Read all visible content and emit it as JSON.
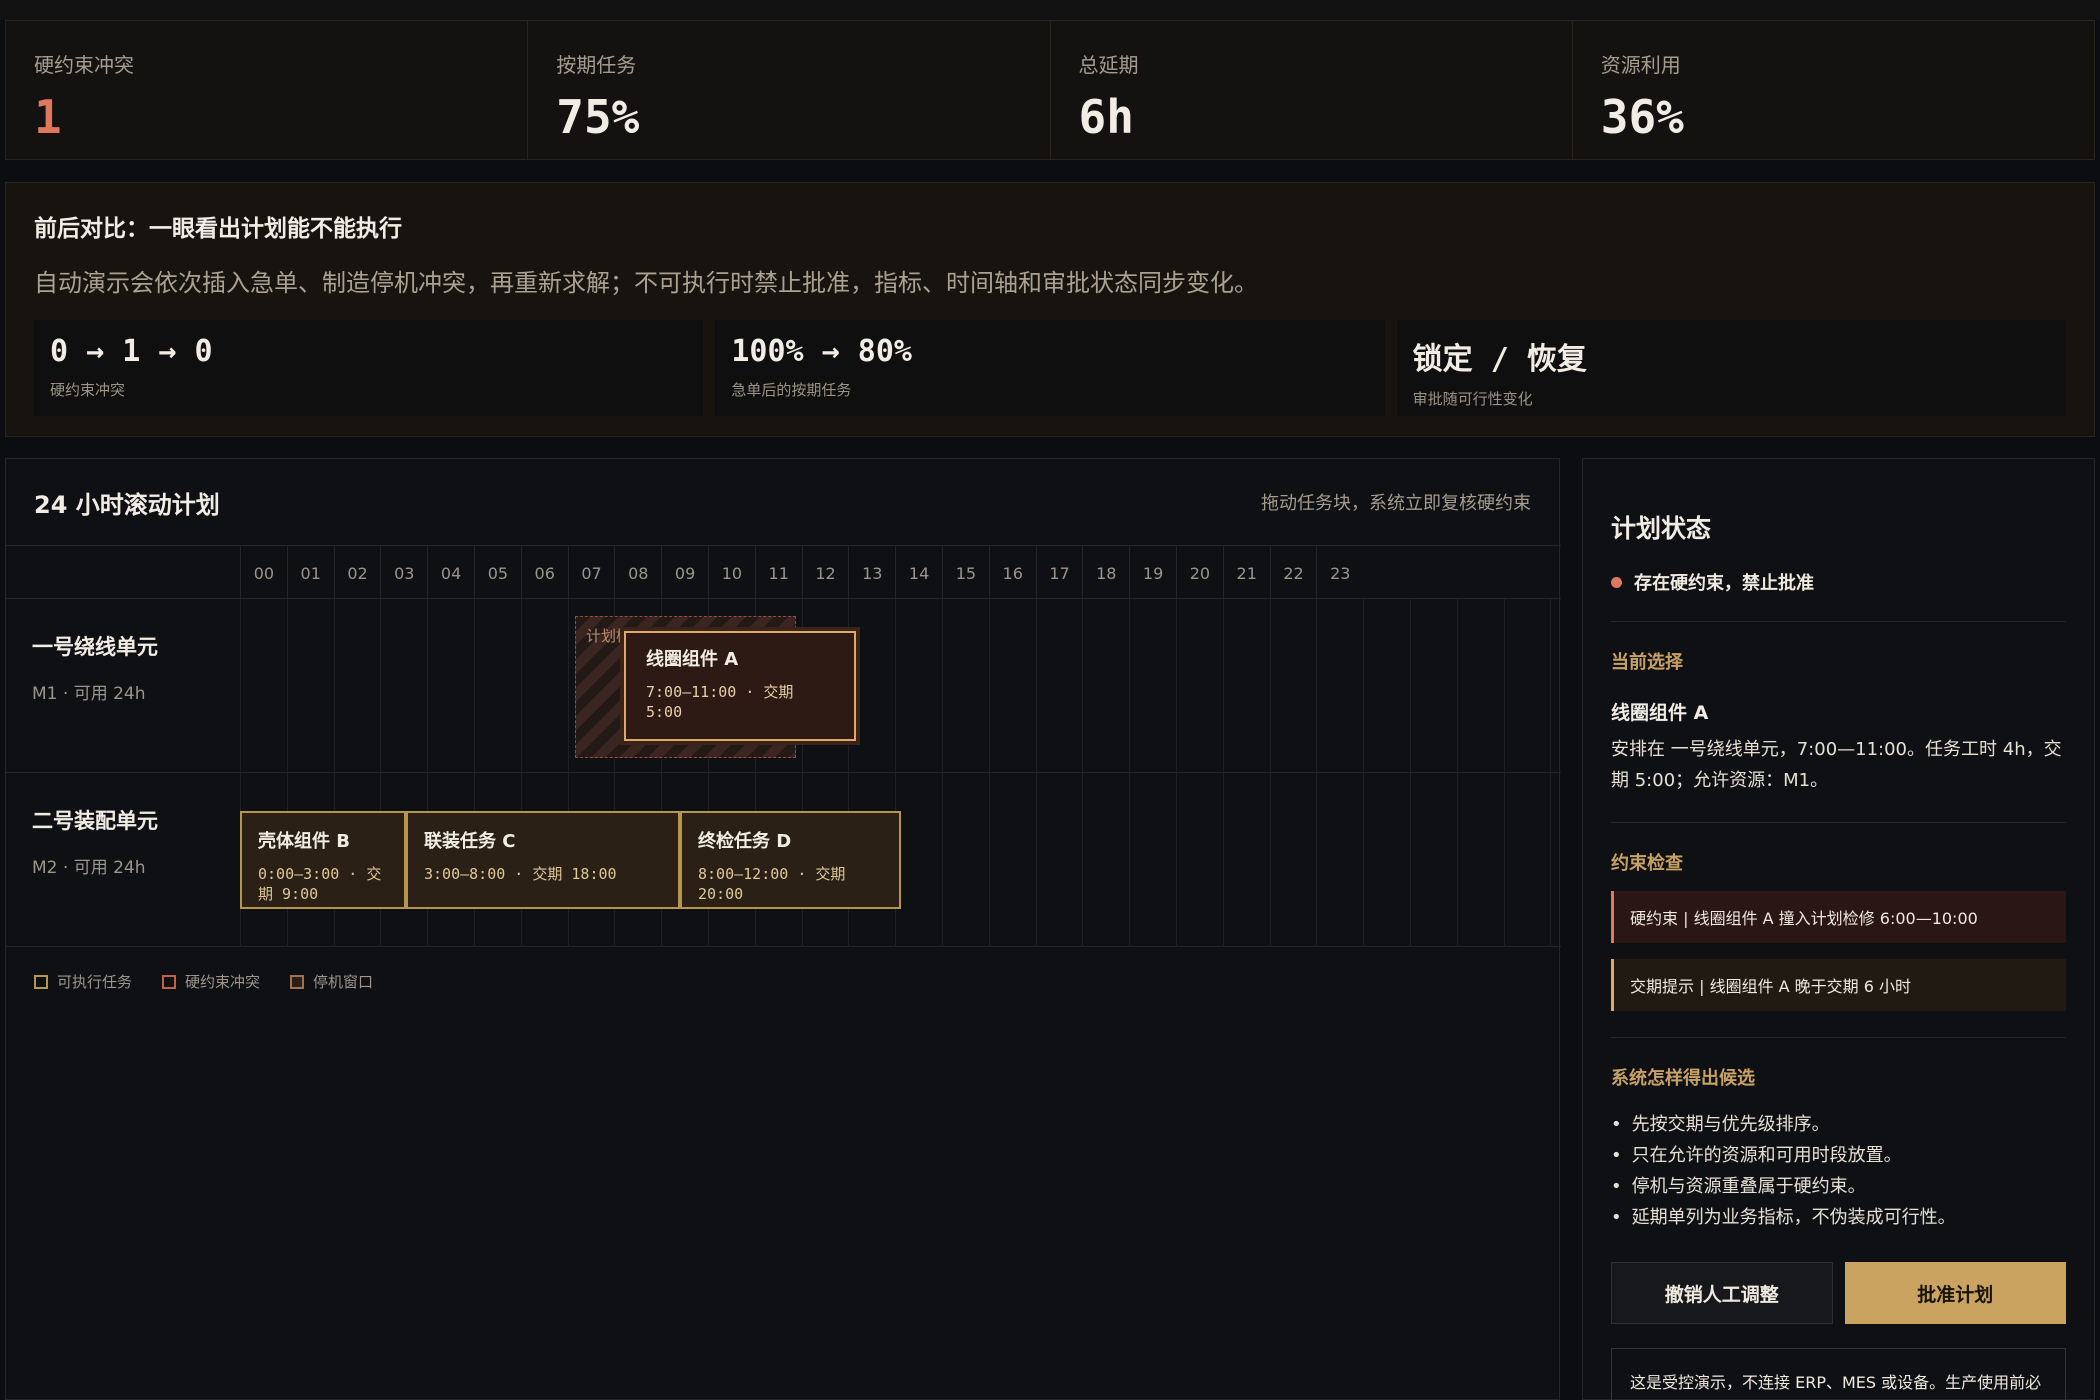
{
  "metrics": [
    {
      "label": "硬约束冲突",
      "value": "1",
      "status_color": "#e07860"
    },
    {
      "label": "按期任务",
      "value": "75%"
    },
    {
      "label": "总延期",
      "value": "6h"
    },
    {
      "label": "资源利用",
      "value": "36%"
    }
  ],
  "compare": {
    "title": "前后对比：一眼看出计划能不能执行",
    "description": "自动演示会依次插入急单、制造停机冲突，再重新求解；不可执行时禁止批准，指标、时间轴和审批状态同步变化。",
    "cards": [
      {
        "main": "0 → 1 → 0",
        "sub": "硬约束冲突"
      },
      {
        "main": "100% → 80%",
        "sub": "急单后的按期任务"
      },
      {
        "main": "锁定 / 恢复",
        "sub": "审批随可行性变化"
      }
    ]
  },
  "gantt": {
    "title": "24 小时滚动计划",
    "hint": "拖动任务块，系统立即复核硬约束",
    "hours": [
      "00",
      "01",
      "02",
      "03",
      "04",
      "05",
      "06",
      "07",
      "08",
      "09",
      "10",
      "11",
      "12",
      "13",
      "14",
      "15",
      "16",
      "17",
      "18",
      "19",
      "20",
      "21",
      "22",
      "23"
    ],
    "lanes": [
      {
        "name": "一号绕线单元",
        "sub": "M1 · 可用 24h",
        "maintenance_label": "计划检修",
        "tasks": [
          {
            "name": "线圈组件 A",
            "time": "7:00–11:00 · 交期 5:00"
          }
        ]
      },
      {
        "name": "二号装配单元",
        "sub": "M2 · 可用 24h",
        "tasks": [
          {
            "name": "壳体组件 B",
            "time": "0:00–3:00 · 交期 9:00"
          },
          {
            "name": "联装任务 C",
            "time": "3:00–8:00 · 交期 18:00"
          },
          {
            "name": "终检任务 D",
            "time": "8:00–12:00 · 交期 20:00"
          }
        ]
      }
    ],
    "legend": [
      "可执行任务",
      "硬约束冲突",
      "停机窗口"
    ]
  },
  "status": {
    "title": "计划状态",
    "alert": "存在硬约束，禁止批准",
    "selection_title": "当前选择",
    "selection_name": "线圈组件 A",
    "selection_desc": "安排在 一号绕线单元，7:00—11:00。任务工时 4h，交期 5:00；允许资源：M1。",
    "checks_title": "约束检查",
    "checks": [
      {
        "type": "hard",
        "text": "硬约束 | 线圈组件 A 撞入计划检修 6:00—10:00"
      },
      {
        "type": "warn",
        "text": "交期提示 | 线圈组件 A 晚于交期 6 小时"
      }
    ],
    "method_title": "系统怎样得出候选",
    "method_items": [
      "先按交期与优先级排序。",
      "只在允许的资源和可用时段放置。",
      "停机与资源重叠属于硬约束。",
      "延期单列为业务指标，不伪装成可行性。"
    ],
    "buttons": {
      "undo": "撤销人工调整",
      "approve": "批准计划"
    },
    "note": "这是受控演示，不连接 ERP、MES 或设备。生产使用前必须用企业真实脱敏数据建模、历史回放、并行试运行，并由计划负责人审核与确认。"
  },
  "colors": {
    "accent": "#c9a35f",
    "conflict": "#e07860",
    "background": "#0b0d10"
  }
}
